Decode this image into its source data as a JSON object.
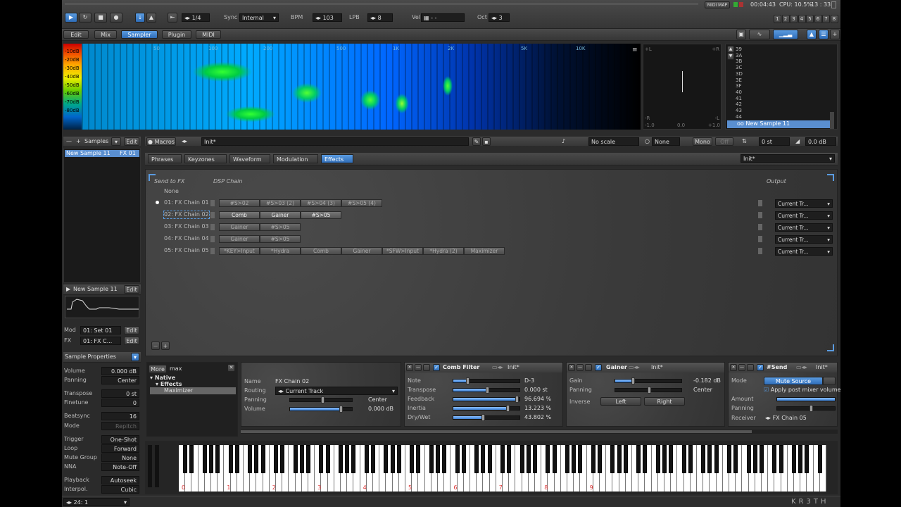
{
  "transport": {
    "pattern_rate": "1/4",
    "sync_label": "Sync",
    "sync_value": "Internal",
    "bpm_label": "BPM",
    "bpm_value": "103",
    "lpb_label": "LPB",
    "lpb_value": "8",
    "vel_label": "Vel",
    "vel_value": "- -",
    "oct_label": "Oct",
    "oct_value": "3",
    "midi_map": "MIDI MAP",
    "time": "00:04:43",
    "cpu": "CPU: 10.5%",
    "clock": "13 : 33",
    "track_buttons": [
      "1",
      "2",
      "3",
      "4",
      "5",
      "6",
      "7",
      "8"
    ]
  },
  "view_tabs": [
    {
      "label": "Edit"
    },
    {
      "label": "Mix"
    },
    {
      "label": "Sampler"
    },
    {
      "label": "Plugin"
    },
    {
      "label": "MIDI"
    }
  ],
  "spectrum": {
    "db_labels": [
      "-10dB",
      "-20dB",
      "-30dB",
      "-40dB",
      "-50dB",
      "-60dB",
      "-70dB",
      "-80dB"
    ],
    "freq_labels": [
      "50",
      "100",
      "200",
      "500",
      "1K",
      "2K",
      "5K",
      "10K"
    ],
    "scope_left_top": "+L",
    "scope_right_top": "+R",
    "scope_left_bottom": "-R",
    "scope_right_bottom": "-L",
    "scope_axis": [
      "-1.0",
      "0.0",
      "+1.0"
    ],
    "note_list": [
      "39",
      "3A",
      "3B",
      "3C",
      "3D",
      "3E",
      "3F",
      "40",
      "41",
      "42",
      "43",
      "44"
    ],
    "sample_name": "oo New Sample 11"
  },
  "samples_panel": {
    "title": "Samples",
    "edit": "Edit",
    "item": "New Sample 11",
    "item_fx": "FX 01",
    "wave_title": "New Sample 11",
    "wave_edit": "Edit",
    "mod_label": "Mod",
    "mod_value": "01: Set 01",
    "mod_edit": "Edit",
    "fx_label": "FX",
    "fx_value": "01: FX C...",
    "fx_edit": "Edit"
  },
  "sample_properties": {
    "title": "Sample Properties",
    "rows": [
      {
        "label": "Volume",
        "value": "0.000 dB"
      },
      {
        "label": "Panning",
        "value": "Center"
      },
      {
        "label": "Transpose",
        "value": "0 st"
      },
      {
        "label": "Finetune",
        "value": "0"
      },
      {
        "label": "Beatsync",
        "value": "16"
      },
      {
        "label": "Mode",
        "value": "Repitch"
      },
      {
        "label": "Trigger",
        "value": "One-Shot"
      },
      {
        "label": "Loop",
        "value": "Forward"
      },
      {
        "label": "Mute Group",
        "value": "None"
      },
      {
        "label": "NNA",
        "value": "Note-Off"
      },
      {
        "label": "Playback",
        "value": "Autoseek"
      },
      {
        "label": "Interpol.",
        "value": "Cubic"
      }
    ]
  },
  "instrument_bar": {
    "macros": "Macros",
    "preset": "Init*",
    "scale": "No scale",
    "key": "None",
    "mono": "Mono",
    "off": "Off",
    "transpose": "0 st",
    "volume": "0.0 dB"
  },
  "editor_tabs": [
    {
      "label": "Phrases"
    },
    {
      "label": "Keyzones"
    },
    {
      "label": "Waveform"
    },
    {
      "label": "Modulation"
    },
    {
      "label": "Effects"
    }
  ],
  "effects_preset": "Init*",
  "fx_editor": {
    "send_to_fx": "Send to FX",
    "dsp_chain": "DSP Chain",
    "output": "Output",
    "none": "None",
    "chains": [
      {
        "name": "01: FX Chain 01",
        "devices": [
          "#S>02",
          "#S>03 (2)",
          "#S>04 (3)",
          "#S>05 (4)"
        ],
        "output": "Current Tr..."
      },
      {
        "name": "02: FX Chain 02",
        "devices": [
          "Comb",
          "Gainer",
          "#S>05"
        ],
        "output": "Current Tr..."
      },
      {
        "name": "03: FX Chain 03",
        "devices": [
          "Gainer",
          "#S>05"
        ],
        "output": "Current Tr..."
      },
      {
        "name": "04: FX Chain 04",
        "devices": [
          "Gainer",
          "#S>05"
        ],
        "output": "Current Tr..."
      },
      {
        "name": "05: FX Chain 05",
        "devices": [
          "*KEY>Input",
          "*Hydra",
          "Comb",
          "Gainer",
          "*SFW>Input",
          "*Hydra (2)",
          "Maximizer"
        ],
        "output": "Current Tr..."
      }
    ]
  },
  "browser": {
    "more": "More",
    "search": "max",
    "tree": [
      "Native",
      "Effects",
      "Maximizer"
    ]
  },
  "chain_props": {
    "name_label": "Name",
    "name_value": "FX Chain 02",
    "routing_label": "Routing",
    "routing_value": "Current Track",
    "panning_label": "Panning",
    "panning_value": "Center",
    "volume_label": "Volume",
    "volume_value": "0.000 dB"
  },
  "comb_filter": {
    "title": "Comb Filter",
    "preset": "Init*",
    "rows": [
      {
        "label": "Note",
        "value": "D-3",
        "level": 0.2
      },
      {
        "label": "Transpose",
        "value": "0.000 st",
        "level": 0.5
      },
      {
        "label": "Feedback",
        "value": "96.694 %",
        "level": 0.97
      },
      {
        "label": "Inertia",
        "value": "13.223 %",
        "level": 0.82
      },
      {
        "label": "Dry/Wet",
        "value": "43.802 %",
        "level": 0.44
      }
    ]
  },
  "gainer": {
    "title": "Gainer",
    "preset": "Init*",
    "gain_label": "Gain",
    "gain_value": "-0.182 dB",
    "panning_label": "Panning",
    "panning_value": "Center",
    "inverse_label": "Inverse",
    "left": "Left",
    "right": "Right"
  },
  "send": {
    "title": "#Send",
    "preset": "Init*",
    "mode_label": "Mode",
    "mode_value": "Mute Source",
    "apply_post": "Apply post mixer volume",
    "amount_label": "Amount",
    "panning_label": "Panning",
    "receiver_label": "Receiver",
    "receiver_value": "FX Chain 05"
  },
  "keyboard": {
    "octaves": [
      "0",
      "1",
      "2",
      "3",
      "4",
      "5",
      "6",
      "7",
      "8",
      "9"
    ]
  },
  "status": {
    "zoom": "24: 1"
  },
  "watermark": "KR3TH"
}
